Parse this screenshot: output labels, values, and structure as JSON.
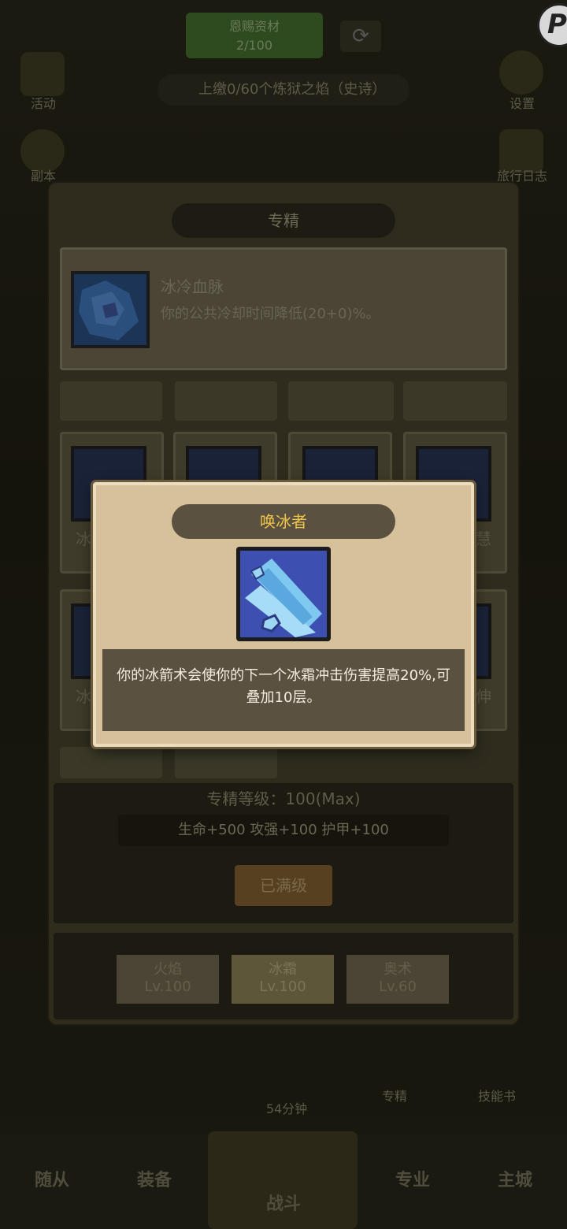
{
  "background": {
    "top_resource": {
      "label": "恩赐资材",
      "value": "2/100"
    },
    "quest_text": "上缴0/60个炼狱之焰（史诗）",
    "left_side": [
      {
        "label": "活动"
      },
      {
        "label": "副本"
      }
    ],
    "right_side": [
      {
        "label": "设置"
      },
      {
        "label": "旅行日志"
      }
    ],
    "bottom_row_labels": {
      "timer": "54分钟",
      "spec": "专精",
      "skillbook": "技能书"
    },
    "bottom_nav": [
      "随从",
      "装备",
      "战斗",
      "专业",
      "主城"
    ]
  },
  "panel": {
    "title": "专精",
    "selected": {
      "name": "冰冷血脉",
      "description": "你的公共冷却时间降低(20+0)%。"
    },
    "tile_labels": [
      "冰",
      "慧",
      "冰",
      "伸"
    ],
    "level_text": "专精等级：100(Max)",
    "stats_text": "生命+500  攻强+100  护甲+100",
    "max_button": "已满级",
    "tabs": [
      {
        "name": "火焰",
        "level": "Lv.100"
      },
      {
        "name": "冰霜",
        "level": "Lv.100"
      },
      {
        "name": "奥术",
        "level": "Lv.60"
      }
    ]
  },
  "modal": {
    "title": "唤冰者",
    "description": "你的冰箭术会使你的下一个冰霜冲击伤害提高20%,可叠加10层。"
  }
}
